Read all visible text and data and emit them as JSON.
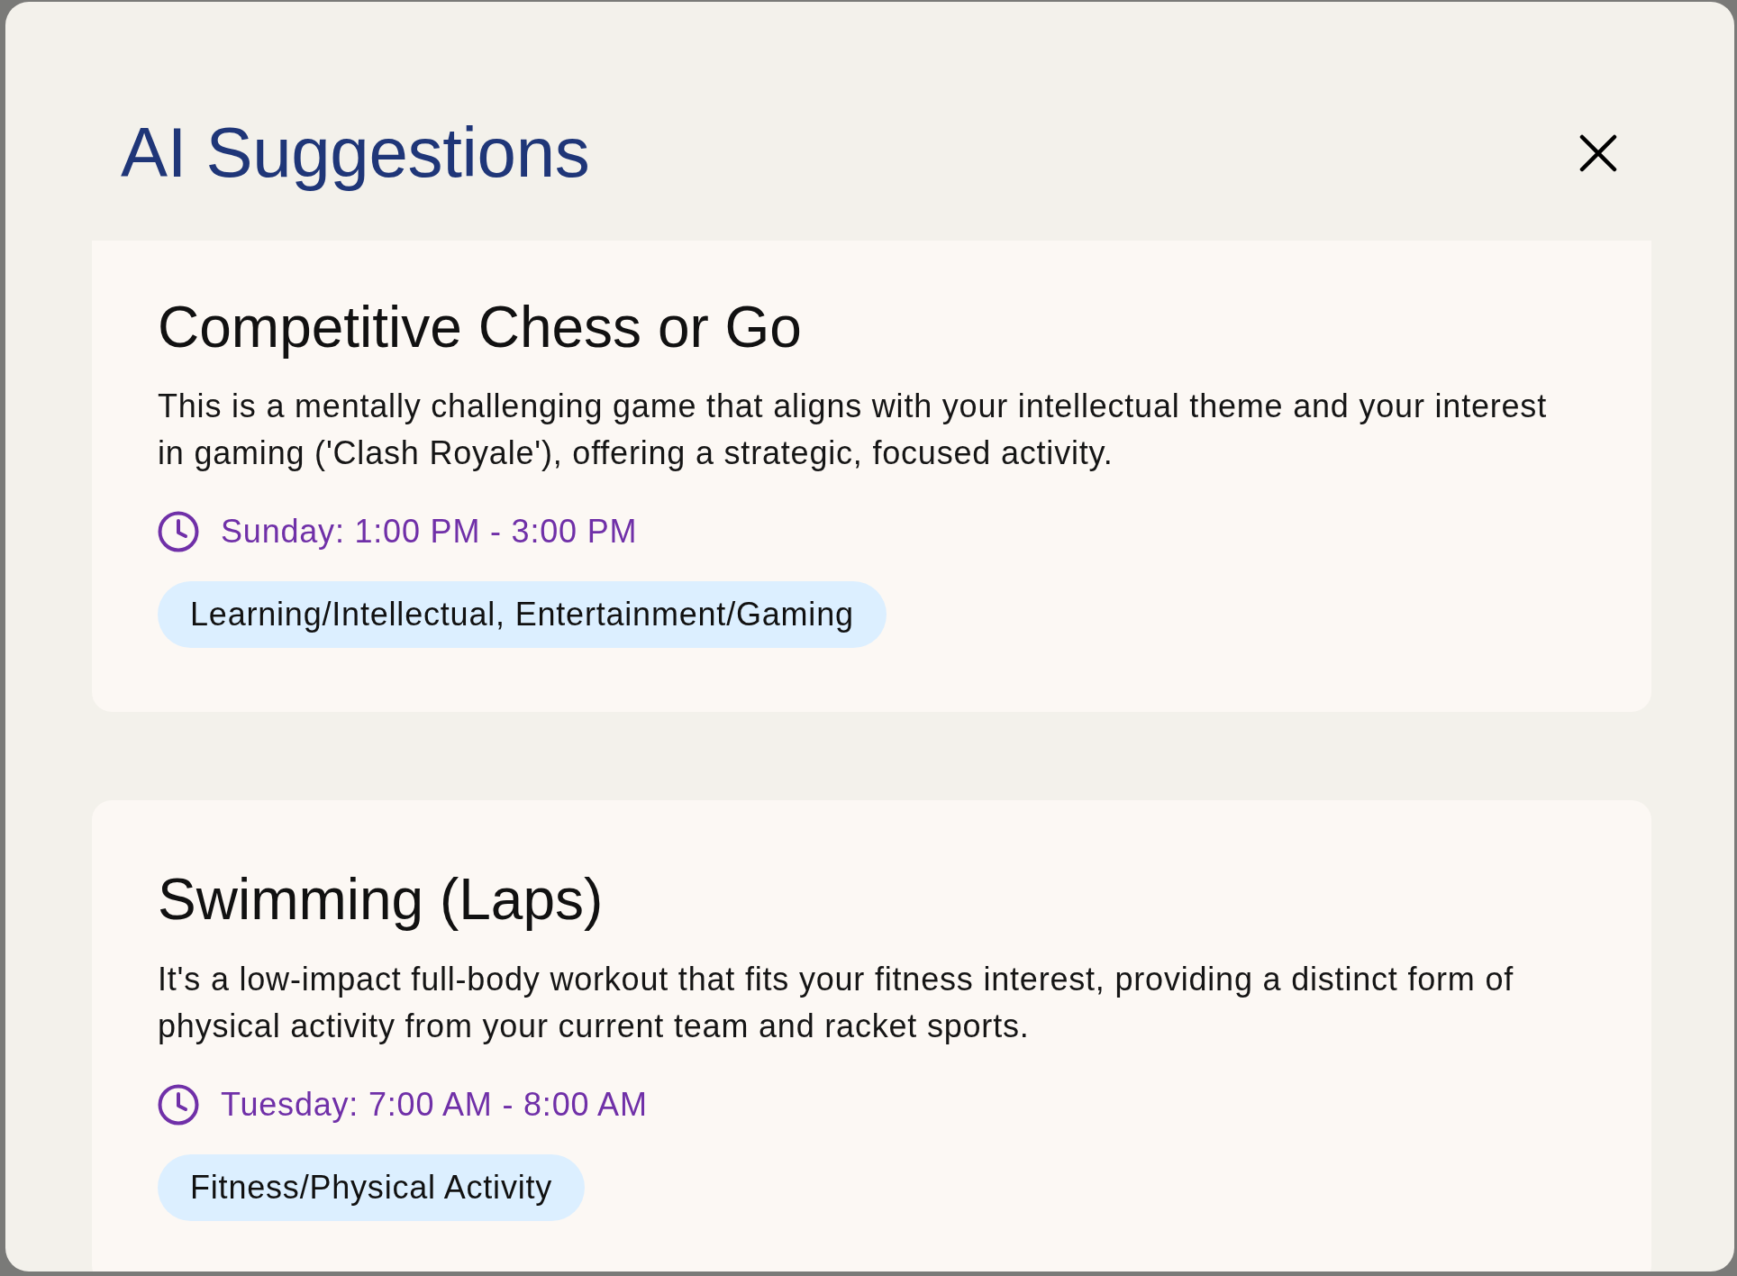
{
  "dialog": {
    "title": "AI Suggestions"
  },
  "suggestions": [
    {
      "title": "Competitive Chess or Go",
      "description": "This is a mentally challenging game that aligns with your intellectual theme and your interest in gaming ('Clash Royale'), offering a strategic, focused activity.",
      "time": "Sunday: 1:00 PM - 3:00 PM",
      "category": "Learning/Intellectual, Entertainment/Gaming"
    },
    {
      "title": "Swimming (Laps)",
      "description": "It's a low-impact full-body workout that fits your fitness interest, providing a distinct form of physical activity from your current team and racket sports.",
      "time": "Tuesday: 7:00 AM - 8:00 AM",
      "category": "Fitness/Physical Activity"
    }
  ]
}
